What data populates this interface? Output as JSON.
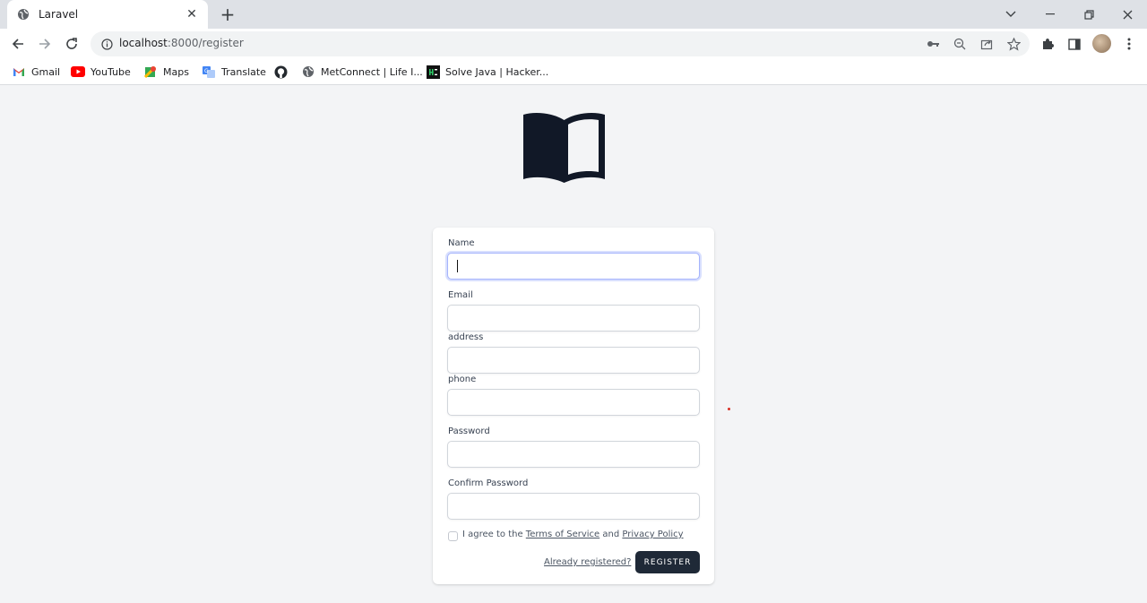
{
  "browser": {
    "tab_title": "Laravel",
    "url_host": "localhost",
    "url_path": ":8000/register",
    "bookmarks": [
      {
        "label": "Gmail"
      },
      {
        "label": "YouTube"
      },
      {
        "label": "Maps"
      },
      {
        "label": "Translate"
      },
      {
        "label": ""
      },
      {
        "label": "MetConnect | Life I..."
      },
      {
        "label": "Solve Java | Hacker..."
      }
    ]
  },
  "form": {
    "name_label": "Name",
    "email_label": "Email",
    "address_label": "address",
    "phone_label": "phone",
    "password_label": "Password",
    "confirm_password_label": "Confirm Password",
    "agree_prefix": "I agree to the",
    "terms_link": "Terms of Service",
    "agree_and": "and",
    "privacy_link": "Privacy Policy",
    "already_registered": "Already registered?",
    "register_button": "REGISTER",
    "agree_checked": false
  },
  "colors": {
    "page_background": "#f3f4f6",
    "button_background": "#1f2937",
    "logo": "#111827",
    "focus_ring": "#a5b4fc"
  }
}
